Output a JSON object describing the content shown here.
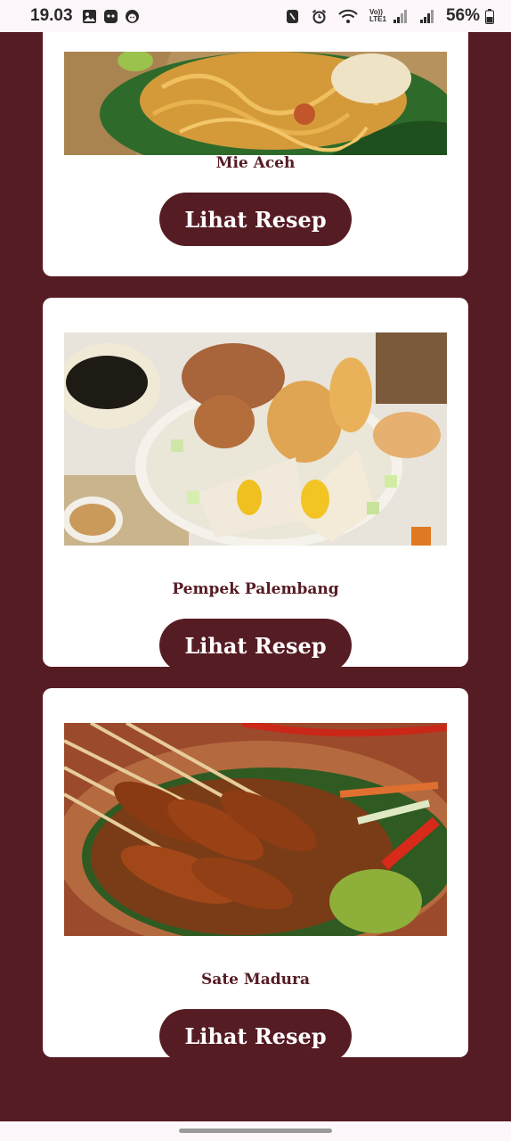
{
  "status_bar": {
    "time": "19.03",
    "network_label": "Vo)) LTE1",
    "battery_percent": "56%",
    "icons": [
      "gallery-icon",
      "game-controller-icon",
      "face-icon",
      "nfc-icon",
      "alarm-icon",
      "wifi-icon",
      "signal-icon",
      "signal-icon",
      "battery-icon"
    ]
  },
  "colors": {
    "background": "#561c24",
    "card": "#ffffff",
    "accent": "#561c24"
  },
  "recipes": [
    {
      "name": "Mie Aceh",
      "button_label": "Lihat Resep"
    },
    {
      "name": "Pempek Palembang",
      "button_label": "Lihat Resep"
    },
    {
      "name": "Sate Madura",
      "button_label": "Lihat Resep"
    }
  ]
}
